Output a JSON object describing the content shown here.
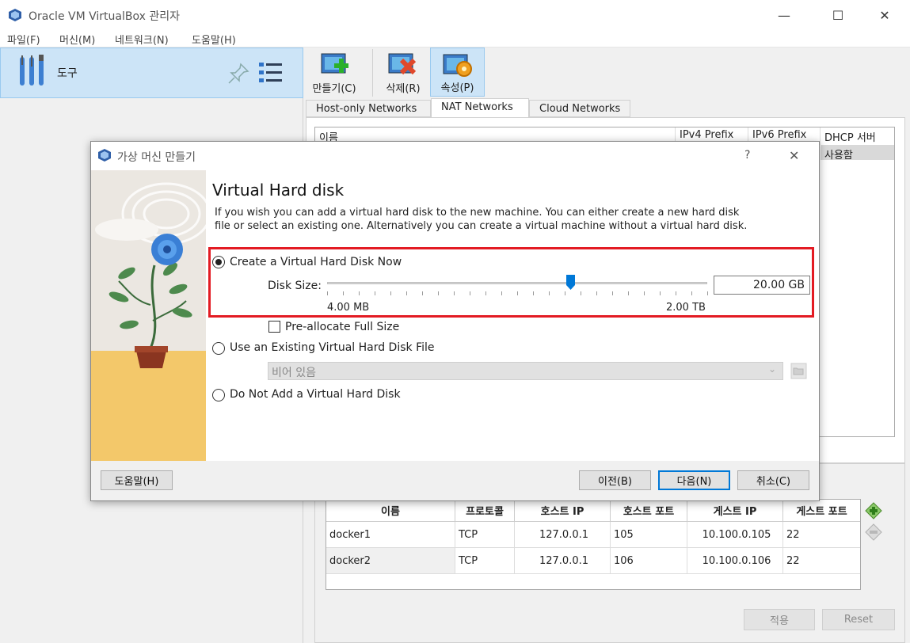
{
  "window": {
    "title": "Oracle VM VirtualBox 관리자",
    "minimize": "—",
    "maximize": "☐",
    "close": "✕"
  },
  "menu": [
    "파일(F)",
    "머신(M)",
    "네트워크(N)",
    "도움말(H)"
  ],
  "sidebar": {
    "tools_label": "도구"
  },
  "toolbar": [
    {
      "label": "만들기(C)",
      "icon": "create-network-icon"
    },
    {
      "label": "삭제(R)",
      "icon": "remove-network-icon"
    },
    {
      "label": "속성(P)",
      "icon": "properties-icon"
    }
  ],
  "tabs": [
    "Host-only Networks",
    "NAT Networks",
    "Cloud Networks"
  ],
  "network_table": {
    "columns": [
      "이름",
      "IPv4 Prefix",
      "IPv6 Prefix",
      "DHCP 서버"
    ],
    "row_value": "사용함"
  },
  "port_forwarding": {
    "columns": [
      "이름",
      "프로토콜",
      "호스트 IP",
      "호스트 포트",
      "게스트 IP",
      "게스트 포트"
    ],
    "rows": [
      [
        "docker1",
        "TCP",
        "127.0.0.1",
        "105",
        "10.100.0.105",
        "22"
      ],
      [
        "docker2",
        "TCP",
        "127.0.0.1",
        "106",
        "10.100.0.106",
        "22"
      ]
    ],
    "apply_label": "적용",
    "reset_label": "Reset"
  },
  "dialog": {
    "title": "가상 머신 만들기",
    "help_glyph": "?",
    "close_glyph": "✕",
    "heading": "Virtual Hard disk",
    "description": "If you wish you can add a virtual hard disk to the new machine. You can either create a new hard disk file or select an existing one. Alternatively you can create a virtual machine without a virtual hard disk.",
    "option_create": "Create a Virtual Hard Disk Now",
    "disk_size_label": "Disk Size:",
    "disk_size_value": "20.00 GB",
    "disk_size_fraction": 0.64,
    "slider_min": "4.00 MB",
    "slider_max": "2.00 TB",
    "preallocate_label": "Pre-allocate Full Size",
    "option_existing": "Use an Existing Virtual Hard Disk File",
    "existing_placeholder": "비어 있음",
    "option_none": "Do Not Add a Virtual Hard Disk",
    "help_button": "도움말(H)",
    "back_button": "이전(B)",
    "next_button": "다음(N)",
    "cancel_button": "취소(C)"
  },
  "colors": {
    "accent": "#0078d7",
    "highlight_box": "#e31b23",
    "selection": "#cce4f7"
  }
}
